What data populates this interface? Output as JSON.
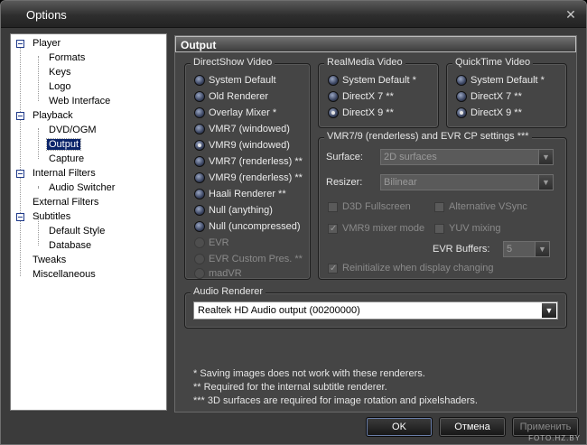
{
  "window": {
    "title": "Options",
    "close_glyph": "✕"
  },
  "tree": {
    "items": [
      {
        "label": "Player",
        "level": 0,
        "expander": true
      },
      {
        "label": "Formats",
        "level": 1
      },
      {
        "label": "Keys",
        "level": 1
      },
      {
        "label": "Logo",
        "level": 1
      },
      {
        "label": "Web Interface",
        "level": 1
      },
      {
        "label": "Playback",
        "level": 0,
        "expander": true
      },
      {
        "label": "DVD/OGM",
        "level": 1
      },
      {
        "label": "Output",
        "level": 1,
        "selected": true
      },
      {
        "label": "Capture",
        "level": 1
      },
      {
        "label": "Internal Filters",
        "level": 0,
        "expander": true
      },
      {
        "label": "Audio Switcher",
        "level": 1
      },
      {
        "label": "External Filters",
        "level": 0
      },
      {
        "label": "Subtitles",
        "level": 0,
        "expander": true
      },
      {
        "label": "Default Style",
        "level": 1
      },
      {
        "label": "Database",
        "level": 1
      },
      {
        "label": "Tweaks",
        "level": 0
      },
      {
        "label": "Miscellaneous",
        "level": 0
      }
    ]
  },
  "panel": {
    "header": "Output"
  },
  "directshow": {
    "title": "DirectShow Video",
    "options": [
      {
        "label": "System Default",
        "checked": false,
        "disabled": false
      },
      {
        "label": "Old Renderer",
        "checked": false,
        "disabled": false
      },
      {
        "label": "Overlay Mixer *",
        "checked": false,
        "disabled": false
      },
      {
        "label": "VMR7 (windowed)",
        "checked": false,
        "disabled": false
      },
      {
        "label": "VMR9 (windowed)",
        "checked": true,
        "disabled": false
      },
      {
        "label": "VMR7 (renderless) **",
        "checked": false,
        "disabled": false
      },
      {
        "label": "VMR9 (renderless) **",
        "checked": false,
        "disabled": false
      },
      {
        "label": "Haali Renderer **",
        "checked": false,
        "disabled": false
      },
      {
        "label": "Null (anything)",
        "checked": false,
        "disabled": false
      },
      {
        "label": "Null (uncompressed)",
        "checked": false,
        "disabled": false
      },
      {
        "label": "EVR",
        "checked": false,
        "disabled": true
      },
      {
        "label": "EVR Custom Pres. **",
        "checked": false,
        "disabled": true
      },
      {
        "label": "madVR",
        "checked": false,
        "disabled": true
      }
    ]
  },
  "realmedia": {
    "title": "RealMedia Video",
    "options": [
      {
        "label": "System Default *",
        "checked": false
      },
      {
        "label": "DirectX 7 **",
        "checked": false
      },
      {
        "label": "DirectX 9 **",
        "checked": true
      }
    ]
  },
  "quicktime": {
    "title": "QuickTime Video",
    "options": [
      {
        "label": "System Default *",
        "checked": false
      },
      {
        "label": "DirectX 7 **",
        "checked": false
      },
      {
        "label": "DirectX 9 **",
        "checked": true
      }
    ]
  },
  "vmr": {
    "title": "VMR7/9 (renderless) and EVR CP settings ***",
    "surface_label": "Surface:",
    "surface_value": "2D surfaces",
    "resizer_label": "Resizer:",
    "resizer_value": "Bilinear",
    "d3d_fullscreen": "D3D Fullscreen",
    "alt_vsync": "Alternative VSync",
    "vmr9_mixer": "VMR9 mixer mode",
    "yuv_mixing": "YUV mixing",
    "evr_buffers_label": "EVR Buffers:",
    "evr_buffers_value": "5",
    "reinit": "Reinitialize when display changing"
  },
  "audio": {
    "title": "Audio Renderer",
    "value": "Realtek HD Audio output (00200000)"
  },
  "footnotes": [
    "* Saving images does not work with these renderers.",
    "** Required for the internal subtitle renderer.",
    "*** 3D surfaces are required for image rotation and pixelshaders."
  ],
  "buttons": {
    "ok": "OK",
    "cancel": "Отмена",
    "apply": "Применить"
  },
  "watermark": "FOTO.HZ.BY",
  "icons": {
    "combo_arrow": "▼"
  }
}
